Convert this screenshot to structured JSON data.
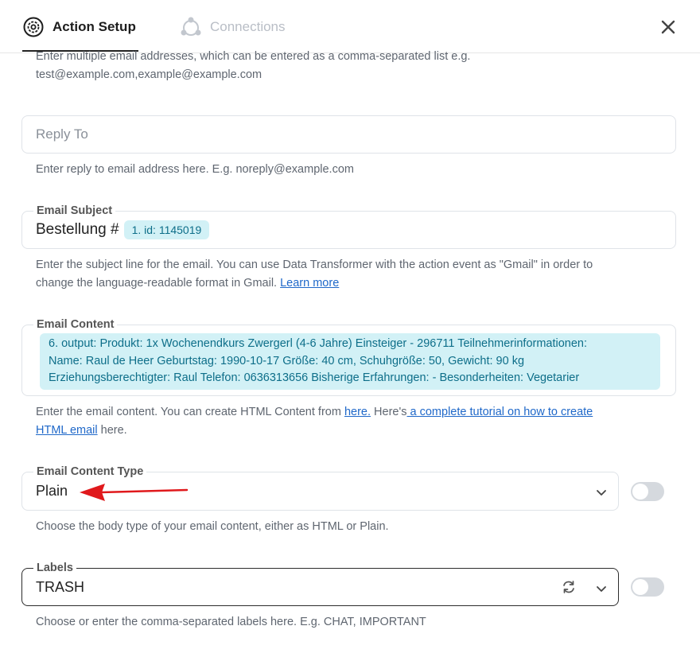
{
  "tabs": {
    "action_setup": "Action Setup",
    "connections": "Connections"
  },
  "top_help": {
    "line1": "Enter multiple email addresses, which can be entered as a comma-separated list e.g.",
    "line2": "test@example.com,example@example.com"
  },
  "reply_to": {
    "placeholder": "Reply To",
    "help": "Enter reply to email address here. E.g. noreply@example.com"
  },
  "email_subject": {
    "label": "Email Subject",
    "text": "Bestellung #",
    "chip": "1. id: 1145019",
    "help_line1": "Enter the subject line for the email. You can use Data Transformer with the action event as \"Gmail\" in order to",
    "help_line2": "change the language-readable format in Gmail.",
    "help_link": "Learn more"
  },
  "email_content": {
    "label": "Email Content",
    "chip_line1": "6. output: Produkt: 1x Wochenendkurs Zwergerl (4-6 Jahre) Einsteiger - 296711 Teilnehmerinformationen:",
    "chip_line2": "Name: Raul de Heer Geburtstag: 1990-10-17 Größe: 40 cm, Schuhgröße: 50, Gewicht: 90 kg",
    "chip_line3": "Erziehungsberechtigter: Raul Telefon: 0636313656 Bisherige Erfahrungen: - Besonderheiten: Vegetarier",
    "help_a": "Enter the email content. You can create HTML Content from",
    "help_link1": "here.",
    "help_b": "Here's",
    "help_link2": " a complete tutorial on how to create",
    "help_link3": "HTML email",
    "help_c": " here."
  },
  "email_content_type": {
    "label": "Email Content Type",
    "value": "Plain",
    "help": "Choose the body type of your email content, either as HTML or Plain.",
    "toggle_on": false
  },
  "labels": {
    "label": "Labels",
    "value": "TRASH",
    "help": "Choose or enter the comma-separated labels here. E.g. CHAT, IMPORTANT",
    "toggle_on": false
  },
  "colors": {
    "chip_bg": "#d2f1f6",
    "chip_text": "#0d6e89",
    "link": "#1f68c9",
    "arrow": "#e0191c"
  }
}
